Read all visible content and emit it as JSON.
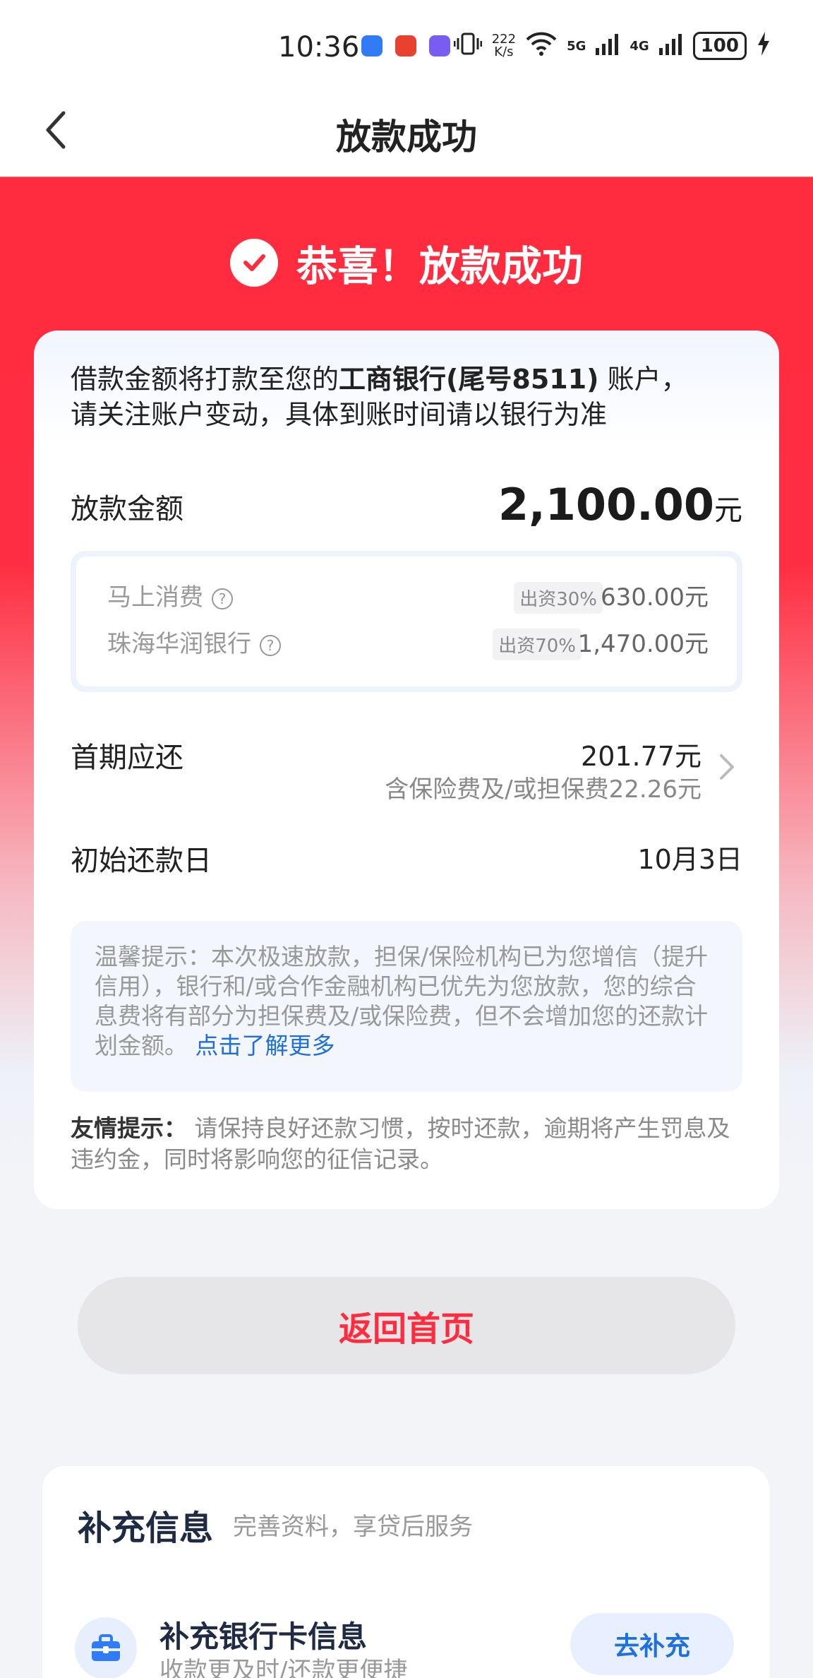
{
  "status_bar": {
    "time": "10:36",
    "speed_top": "222",
    "speed_unit": "K/s",
    "net1": "5G",
    "net2": "4G",
    "battery": "100"
  },
  "header": {
    "title": "放款成功"
  },
  "banner": {
    "text": "恭喜！放款成功"
  },
  "notice": {
    "line1_prefix": "借款金额将打款至您的",
    "bank": "工商银行(尾号8511)",
    "line1_suffix": " 账户，",
    "line2": "请关注账户变动，具体到账时间请以银行为准"
  },
  "loan": {
    "label": "放款金额",
    "amount": "2,100.00",
    "unit": "元",
    "lenders": [
      {
        "name": "马上消费",
        "ratio": "出资30%",
        "amount": "630.00元"
      },
      {
        "name": "珠海华润银行",
        "ratio": "出资70%",
        "amount": "1,470.00元"
      }
    ]
  },
  "first_payment": {
    "label": "首期应还",
    "amount": "201.77元",
    "note": "含保险费及/或担保费22.26元"
  },
  "repay_date": {
    "label": "初始还款日",
    "value": "10月3日"
  },
  "tip": {
    "text": "温馨提示：本次极速放款，担保/保险机构已为您增信（提升信用），银行和/或合作金融机构已优先为您放款，您的综合息费将有部分为担保费及/或保险费，但不会增加您的还款计划金额。",
    "link": "点击了解更多"
  },
  "friendly": {
    "label": "友情提示：",
    "text": " 请保持良好还款习惯，按时还款，逾期将产生罚息及违约金，同时将影响您的征信记录。"
  },
  "home_button": "返回首页",
  "supplement": {
    "title": "补充信息",
    "subtitle": "完善资料，享贷后服务",
    "item_title": "补充银行卡信息",
    "item_sub": "收款更及时/还款更便捷",
    "button": "去补充"
  },
  "colors": {
    "primary_red": "#ff2b3f",
    "link_blue": "#1e6fe0"
  }
}
